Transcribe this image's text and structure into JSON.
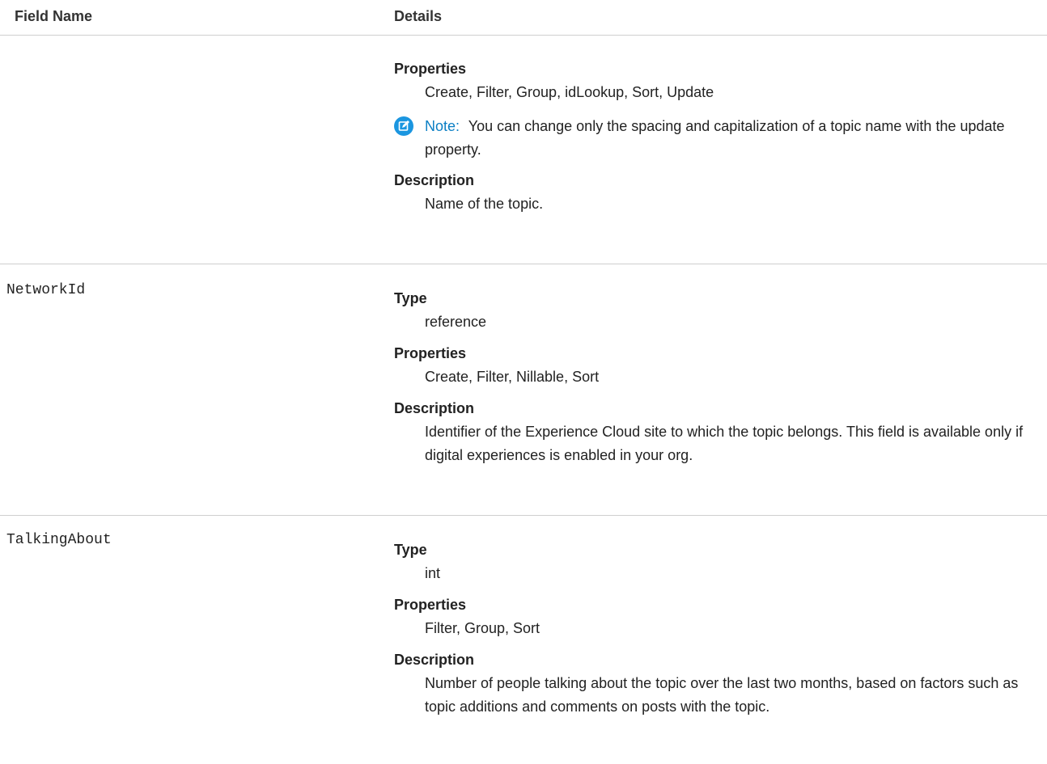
{
  "header": {
    "field_name": "Field Name",
    "details": "Details"
  },
  "rows": [
    {
      "field": "",
      "type_label": "",
      "type_value": "",
      "properties_label": "Properties",
      "properties_value": "Create, Filter, Group, idLookup, Sort, Update",
      "note_label": "Note:",
      "note_text": "You can change only the spacing and capitalization of a topic name with the update property.",
      "description_label": "Description",
      "description_value": "Name of the topic."
    },
    {
      "field": "NetworkId",
      "type_label": "Type",
      "type_value": "reference",
      "properties_label": "Properties",
      "properties_value": "Create, Filter, Nillable, Sort",
      "description_label": "Description",
      "description_value": "Identifier of the Experience Cloud site to which the topic belongs. This field is available only if digital experiences is enabled in your org."
    },
    {
      "field": "TalkingAbout",
      "type_label": "Type",
      "type_value": "int",
      "properties_label": "Properties",
      "properties_value": "Filter, Group, Sort",
      "description_label": "Description",
      "description_value": "Number of people talking about the topic over the last two months, based on factors such as topic additions and comments on posts with the topic."
    }
  ],
  "colors": {
    "note_accent": "#0b7fc4",
    "divider": "#cfcfcf"
  },
  "icons": {
    "note": "edit-note-icon"
  }
}
